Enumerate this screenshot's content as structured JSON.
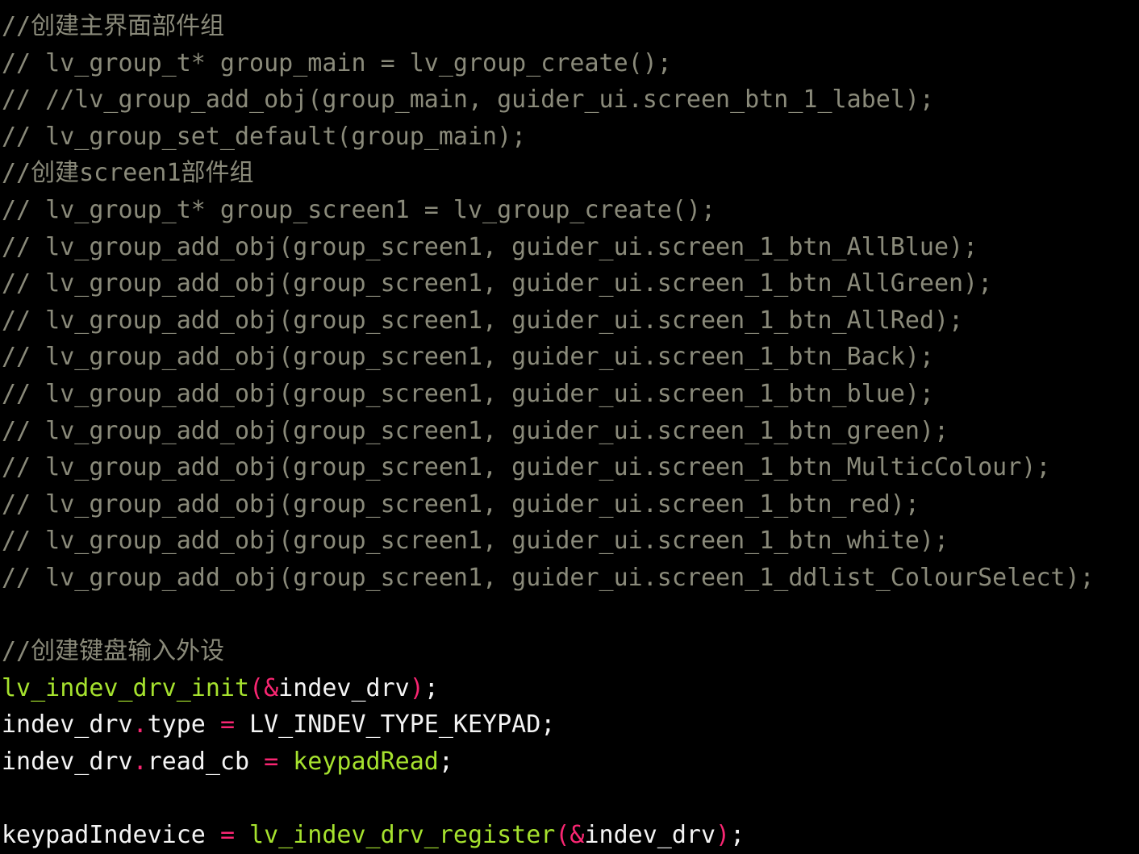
{
  "colors": {
    "background": "#000000",
    "comment": "#8a8a7a",
    "function": "#a6e22e",
    "operator": "#f92672",
    "identifier": "#f4f4f4"
  },
  "lines": [
    [
      {
        "t": "comment",
        "v": "//创建主界面部件组"
      }
    ],
    [
      {
        "t": "comment",
        "v": "// lv_group_t* group_main = lv_group_create();"
      }
    ],
    [
      {
        "t": "comment",
        "v": "// //lv_group_add_obj(group_main, guider_ui.screen_btn_1_label);"
      }
    ],
    [
      {
        "t": "comment",
        "v": "// lv_group_set_default(group_main);"
      }
    ],
    [
      {
        "t": "comment",
        "v": "//创建screen1部件组"
      }
    ],
    [
      {
        "t": "comment",
        "v": "// lv_group_t* group_screen1 = lv_group_create();"
      }
    ],
    [
      {
        "t": "comment",
        "v": "// lv_group_add_obj(group_screen1, guider_ui.screen_1_btn_AllBlue);"
      }
    ],
    [
      {
        "t": "comment",
        "v": "// lv_group_add_obj(group_screen1, guider_ui.screen_1_btn_AllGreen);"
      }
    ],
    [
      {
        "t": "comment",
        "v": "// lv_group_add_obj(group_screen1, guider_ui.screen_1_btn_AllRed);"
      }
    ],
    [
      {
        "t": "comment",
        "v": "// lv_group_add_obj(group_screen1, guider_ui.screen_1_btn_Back);"
      }
    ],
    [
      {
        "t": "comment",
        "v": "// lv_group_add_obj(group_screen1, guider_ui.screen_1_btn_blue);"
      }
    ],
    [
      {
        "t": "comment",
        "v": "// lv_group_add_obj(group_screen1, guider_ui.screen_1_btn_green);"
      }
    ],
    [
      {
        "t": "comment",
        "v": "// lv_group_add_obj(group_screen1, guider_ui.screen_1_btn_MulticColour);"
      }
    ],
    [
      {
        "t": "comment",
        "v": "// lv_group_add_obj(group_screen1, guider_ui.screen_1_btn_red);"
      }
    ],
    [
      {
        "t": "comment",
        "v": "// lv_group_add_obj(group_screen1, guider_ui.screen_1_btn_white);"
      }
    ],
    [
      {
        "t": "comment",
        "v": "// lv_group_add_obj(group_screen1, guider_ui.screen_1_ddlist_ColourSelect);"
      }
    ],
    [],
    [
      {
        "t": "comment",
        "v": "//创建键盘输入外设"
      }
    ],
    [
      {
        "t": "func",
        "v": "lv_indev_drv_init"
      },
      {
        "t": "op",
        "v": "(&"
      },
      {
        "t": "ident",
        "v": "indev_drv"
      },
      {
        "t": "op",
        "v": ")"
      },
      {
        "t": "punct",
        "v": ";"
      }
    ],
    [
      {
        "t": "ident",
        "v": "indev_drv"
      },
      {
        "t": "op",
        "v": "."
      },
      {
        "t": "ident",
        "v": "type "
      },
      {
        "t": "op",
        "v": "="
      },
      {
        "t": "macro",
        "v": " LV_INDEV_TYPE_KEYPAD"
      },
      {
        "t": "punct",
        "v": ";"
      }
    ],
    [
      {
        "t": "ident",
        "v": "indev_drv"
      },
      {
        "t": "op",
        "v": "."
      },
      {
        "t": "ident",
        "v": "read_cb "
      },
      {
        "t": "op",
        "v": "="
      },
      {
        "t": "func",
        "v": " keypadRead"
      },
      {
        "t": "punct",
        "v": ";"
      }
    ],
    [],
    [
      {
        "t": "ident",
        "v": "keypadIndevice "
      },
      {
        "t": "op",
        "v": "="
      },
      {
        "t": "func",
        "v": " lv_indev_drv_register"
      },
      {
        "t": "op",
        "v": "(&"
      },
      {
        "t": "ident",
        "v": "indev_drv"
      },
      {
        "t": "op",
        "v": ")"
      },
      {
        "t": "punct",
        "v": ";"
      }
    ]
  ]
}
